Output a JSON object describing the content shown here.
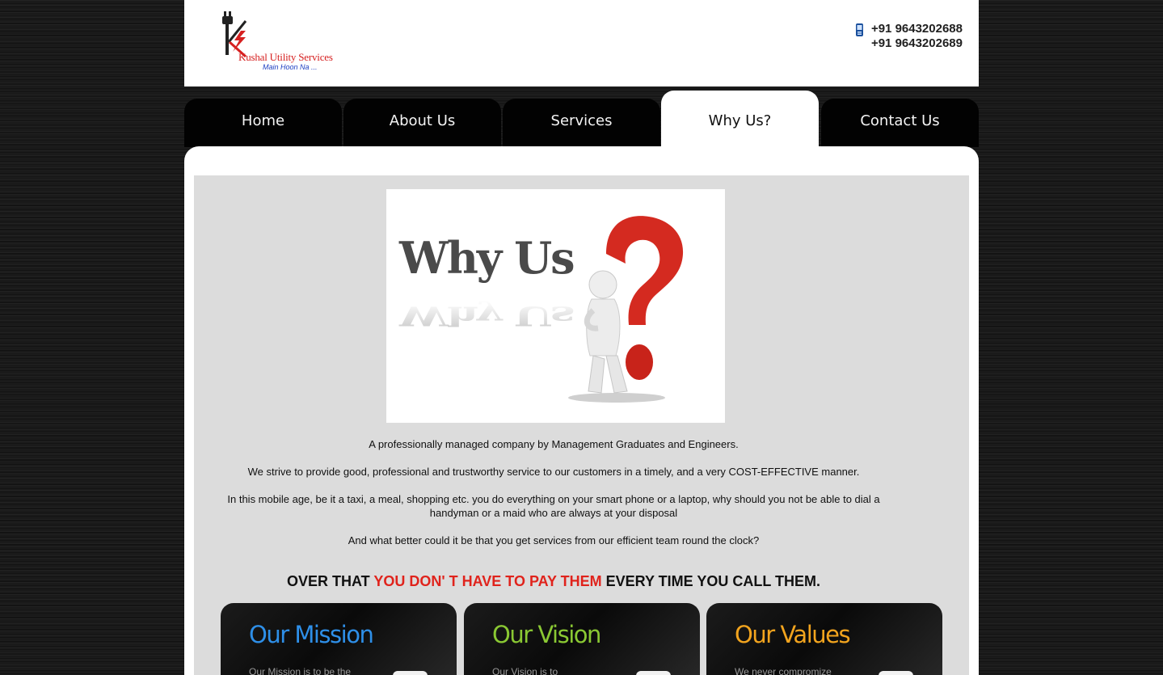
{
  "header": {
    "logo_name": "Kushal Utility Services",
    "logo_tagline": "Main Hoon Na ...",
    "phones": [
      "+91 9643202688",
      "+91 9643202689"
    ],
    "phone_icon": "mobile-phone-icon"
  },
  "nav": {
    "tabs": [
      {
        "label": "Home"
      },
      {
        "label": "About Us"
      },
      {
        "label": "Services"
      },
      {
        "label": "Why Us?"
      },
      {
        "label": "Contact Us"
      }
    ],
    "active_tab": "Why Us?"
  },
  "hero": {
    "title": "Why Us",
    "question_mark_color": "#d42a20"
  },
  "content": {
    "paragraphs": [
      "A professionally managed company by Management Graduates and Engineers.",
      "We strive to provide good, professional and trustworthy service to our customers in a timely, and a very COST-EFFECTIVE manner.",
      "In this mobile age, be it a taxi, a meal, shopping etc. you do everything on your smart phone or a laptop, why should you not be able to dial a handyman or a maid who are always at your disposal",
      "And what better could it be that you get services from our efficient team round the clock?"
    ],
    "tagline": {
      "part1": "OVER THAT ",
      "highlight": "YOU DON' T HAVE TO PAY THEM",
      "part2": " EVERY TIME YOU CALL THEM.",
      "highlight_color": "#e0231c"
    }
  },
  "boxes": [
    {
      "title": "Our Mission",
      "text": "Our Mission is to be the",
      "color": "#2e8fe8"
    },
    {
      "title": "Our Vision",
      "text": "Our Vision is to",
      "color": "#8ac833"
    },
    {
      "title": "Our Values",
      "text": "We never compromize",
      "color": "#f2a41e"
    }
  ]
}
